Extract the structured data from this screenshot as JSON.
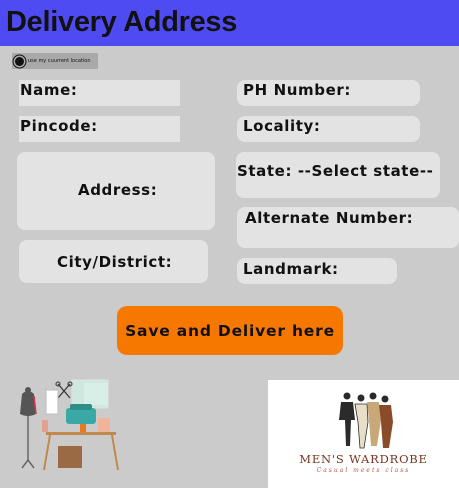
{
  "header": {
    "title": "Delivery Address"
  },
  "location_button": {
    "label": "use my cuurrent location"
  },
  "fields": {
    "name": "Name:",
    "phone": "PH Number:",
    "pincode": "Pincode:",
    "locality": "Locality:",
    "address": "Address:",
    "state": "State: --Select state--",
    "alternate": "Alternate Number:",
    "city": "City/District:",
    "landmark": "Landmark:"
  },
  "actions": {
    "save_label": "Save and Deliver here"
  },
  "brand": {
    "name": "MEN'S WARDROBE",
    "tagline": "Casual meets class"
  },
  "colors": {
    "header": "#4f4bf2",
    "accent": "#f77800",
    "background": "#cbcbcb",
    "field": "#e3e3e3"
  }
}
